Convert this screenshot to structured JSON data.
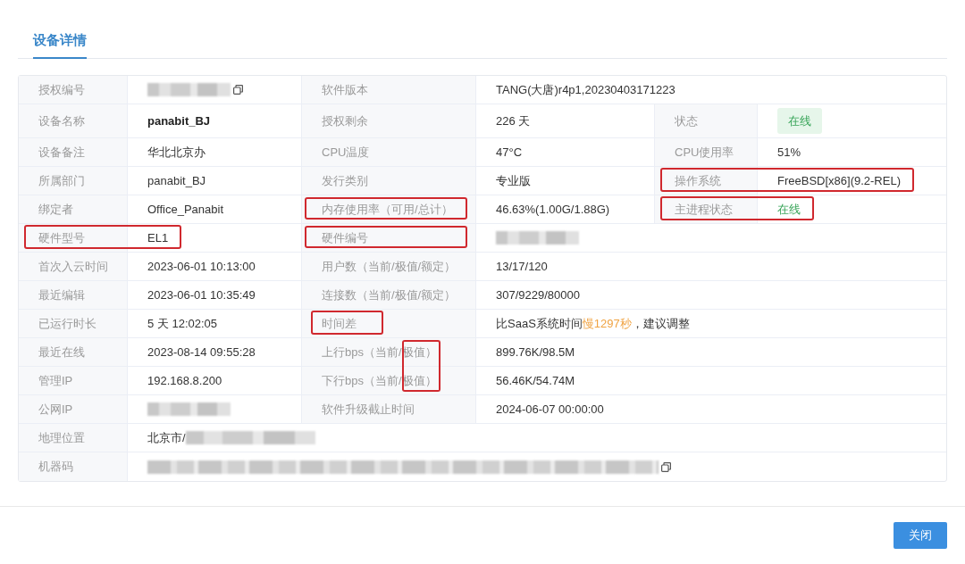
{
  "tabs": [
    {
      "label": "设备详情",
      "selected": true
    }
  ],
  "rows": [
    {
      "fields": [
        {
          "label": "授权编号",
          "kind": "redacted",
          "copy": true
        },
        {
          "label": "软件版本",
          "value": "TANG(大唐)r4p1,20230403171223",
          "kind": "text"
        }
      ]
    },
    {
      "fields": [
        {
          "label": "设备名称",
          "value": "panabit_BJ",
          "kind": "bold"
        },
        {
          "label": "授权剩余",
          "value": "226 天",
          "kind": "text"
        },
        {
          "label": "状态",
          "value": "在线",
          "kind": "badge"
        }
      ]
    },
    {
      "fields": [
        {
          "label": "设备备注",
          "value": "华北北京办",
          "kind": "text"
        },
        {
          "label": "CPU温度",
          "value": "47°C",
          "kind": "text"
        },
        {
          "label": "CPU使用率",
          "value": "51%",
          "kind": "text"
        }
      ]
    },
    {
      "fields": [
        {
          "label": "所属部门",
          "value": "panabit_BJ",
          "kind": "text"
        },
        {
          "label": "发行类别",
          "value": "专业版",
          "kind": "text"
        },
        {
          "label": "操作系统",
          "value": "FreeBSD[x86](9.2-REL)",
          "kind": "text",
          "frame": {
            "kind": "pair"
          }
        }
      ]
    },
    {
      "fields": [
        {
          "label": "绑定者",
          "value": "Office_Panabit",
          "kind": "text"
        },
        {
          "label": "内存使用率（可用/总计）",
          "value": "46.63%(1.00G/1.88G)",
          "kind": "text",
          "frame": {
            "kind": "cell"
          }
        },
        {
          "label": "主进程状态",
          "value": "在线",
          "kind": "status",
          "frame": {
            "kind": "pair"
          }
        }
      ]
    },
    {
      "fields": [
        {
          "label": "硬件型号",
          "value": "EL1",
          "kind": "text",
          "frame": {
            "kind": "pair"
          }
        },
        {
          "label": "硬件编号",
          "kind": "redacted",
          "copy": false,
          "frame": {
            "kind": "cell"
          }
        }
      ]
    },
    {
      "fields": [
        {
          "label": "首次入云时间",
          "value": "2023-06-01 10:13:00",
          "kind": "text"
        },
        {
          "label": "用户数（当前/极值/额定）",
          "value": "13/17/120",
          "kind": "text"
        }
      ]
    },
    {
      "fields": [
        {
          "label": "最近编辑",
          "value": "2023-06-01 10:35:49",
          "kind": "text"
        },
        {
          "label": "连接数（当前/极值/额定）",
          "value": "307/9229/80000",
          "kind": "text"
        }
      ]
    },
    {
      "fields": [
        {
          "label": "已运行时长",
          "value": "5 天 12:02:05",
          "kind": "text"
        },
        {
          "label": "时间差",
          "kind": "parts",
          "parts": [
            {
              "text": "比SaaS系统时间",
              "kind": "plain"
            },
            {
              "text": "慢1297秒",
              "kind": "warning"
            },
            {
              "text": "，建议调整",
              "kind": "plain"
            }
          ],
          "frame": {
            "kind": "text"
          }
        }
      ]
    },
    {
      "fields": [
        {
          "label": "最近在线",
          "value": "2023-08-14 09:55:28",
          "kind": "text"
        },
        {
          "label": "上行bps（当前/极值）",
          "value": "899.76K/98.5M",
          "kind": "text",
          "frame": {
            "kind": "tail"
          }
        }
      ]
    },
    {
      "fields": [
        {
          "label": "管理IP",
          "value": "192.168.8.200",
          "kind": "text"
        },
        {
          "label": "下行bps（当前/极值）",
          "value": "56.46K/54.74M",
          "kind": "text",
          "frame": {
            "kind": "tail"
          }
        }
      ]
    },
    {
      "fields": [
        {
          "label": "公网IP",
          "kind": "redacted",
          "copy": false
        },
        {
          "label": "软件升级截止时间",
          "value": "2024-06-07 00:00:00",
          "kind": "text"
        }
      ]
    },
    {
      "fields": [
        {
          "label": "地理位置",
          "value": "北京市/",
          "kind": "text_redacted",
          "copy": false
        }
      ]
    },
    {
      "fields": [
        {
          "label": "机器码",
          "kind": "redacted_long",
          "copy": true
        }
      ]
    }
  ],
  "close_button": "关闭"
}
